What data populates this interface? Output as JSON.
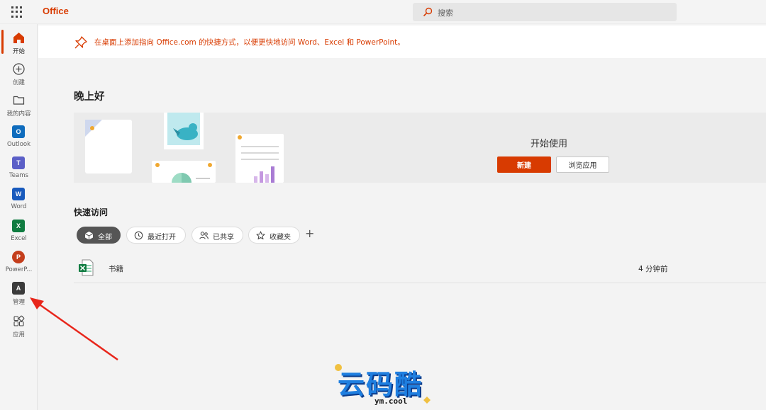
{
  "topbar": {
    "brand": "Office",
    "search_placeholder": "搜索"
  },
  "rail": {
    "items": [
      {
        "label": "开始",
        "icon": "home-icon",
        "active": true
      },
      {
        "label": "创建",
        "icon": "add-circle-icon"
      },
      {
        "label": "我的内容",
        "icon": "folder-icon"
      },
      {
        "label": "Outlook",
        "icon": "outlook-icon"
      },
      {
        "label": "Teams",
        "icon": "teams-icon"
      },
      {
        "label": "Word",
        "icon": "word-icon"
      },
      {
        "label": "Excel",
        "icon": "excel-icon"
      },
      {
        "label": "PowerP...",
        "icon": "powerpoint-icon"
      },
      {
        "label": "管理",
        "icon": "admin-icon"
      },
      {
        "label": "应用",
        "icon": "apps-icon"
      }
    ]
  },
  "banner": {
    "text": "在桌面上添加指向 Office.com 的快捷方式，以便更快地访问 Word、Excel 和 PowerPoint。"
  },
  "greeting": "晚上好",
  "hero": {
    "title": "开始使用",
    "new_button": "新建",
    "browse_button": "浏览应用"
  },
  "quick_access": {
    "title": "快速访问",
    "filters": [
      {
        "label": "全部",
        "active": true
      },
      {
        "label": "最近打开"
      },
      {
        "label": "已共享"
      },
      {
        "label": "收藏夹"
      }
    ],
    "add": "+",
    "files": [
      {
        "name": "书籍",
        "time": "4 分钟前",
        "type": "excel"
      }
    ]
  },
  "colors": {
    "accent": "#d83b01",
    "outlook": "#0f6cbd",
    "teams": "#5b5fc7",
    "word": "#185abd",
    "excel": "#107c41",
    "powerpoint": "#c43e1c",
    "annotation": "#e8261b"
  },
  "watermark": {
    "title": "云码酷",
    "subtitle": "ym.cool"
  }
}
